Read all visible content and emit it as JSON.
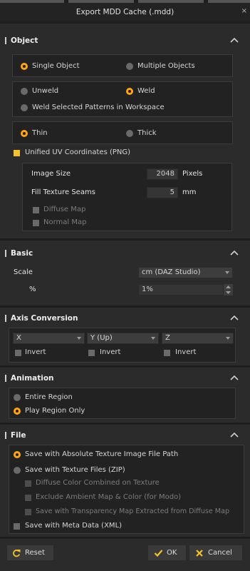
{
  "window": {
    "title": "Export MDD Cache (.mdd)",
    "close": "×"
  },
  "sections": {
    "object": "Object",
    "basic": "Basic",
    "axis": "Axis Conversion",
    "animation": "Animation",
    "file": "File"
  },
  "object": {
    "single": "Single Object",
    "multiple": "Multiple Objects",
    "unweld": "Unweld",
    "weld": "Weld",
    "weld_patterns": "Weld Selected Patterns in Workspace",
    "thin": "Thin",
    "thick": "Thick",
    "unified_uv": "Unified UV Coordinates (PNG)",
    "image_size_label": "Image Size",
    "image_size_value": "2048",
    "image_size_unit": "Pixels",
    "fill_seams_label": "Fill Texture Seams",
    "fill_seams_value": "5",
    "fill_seams_unit": "mm",
    "diffuse_map": "Diffuse Map",
    "normal_map": "Normal Map"
  },
  "basic": {
    "scale_label": "Scale",
    "scale_value": "cm (DAZ Studio)",
    "percent_label": "%",
    "percent_value": "1%"
  },
  "axis": {
    "x": "X",
    "y": "Y (Up)",
    "z": "Z",
    "invert": "Invert"
  },
  "animation": {
    "entire": "Entire Region",
    "play": "Play Region Only"
  },
  "file": {
    "abs_path": "Save with Absolute Texture Image File Path",
    "tex_zip": "Save with Texture Files (ZIP)",
    "diffuse_combined": "Diffuse Color Combined on Texture",
    "exclude_ambient": "Exclude Ambient Map & Color (for Modo)",
    "transparency": "Save with Transparency Map Extracted from Diffuse Map",
    "meta": "Save with Meta Data (XML)"
  },
  "buttons": {
    "reset": "Reset",
    "ok": "OK",
    "cancel": "Cancel"
  },
  "colors": {
    "accent": "#ffa514",
    "check": "#f4c22a",
    "panel": "#222222",
    "bg": "#2b2b2b"
  }
}
